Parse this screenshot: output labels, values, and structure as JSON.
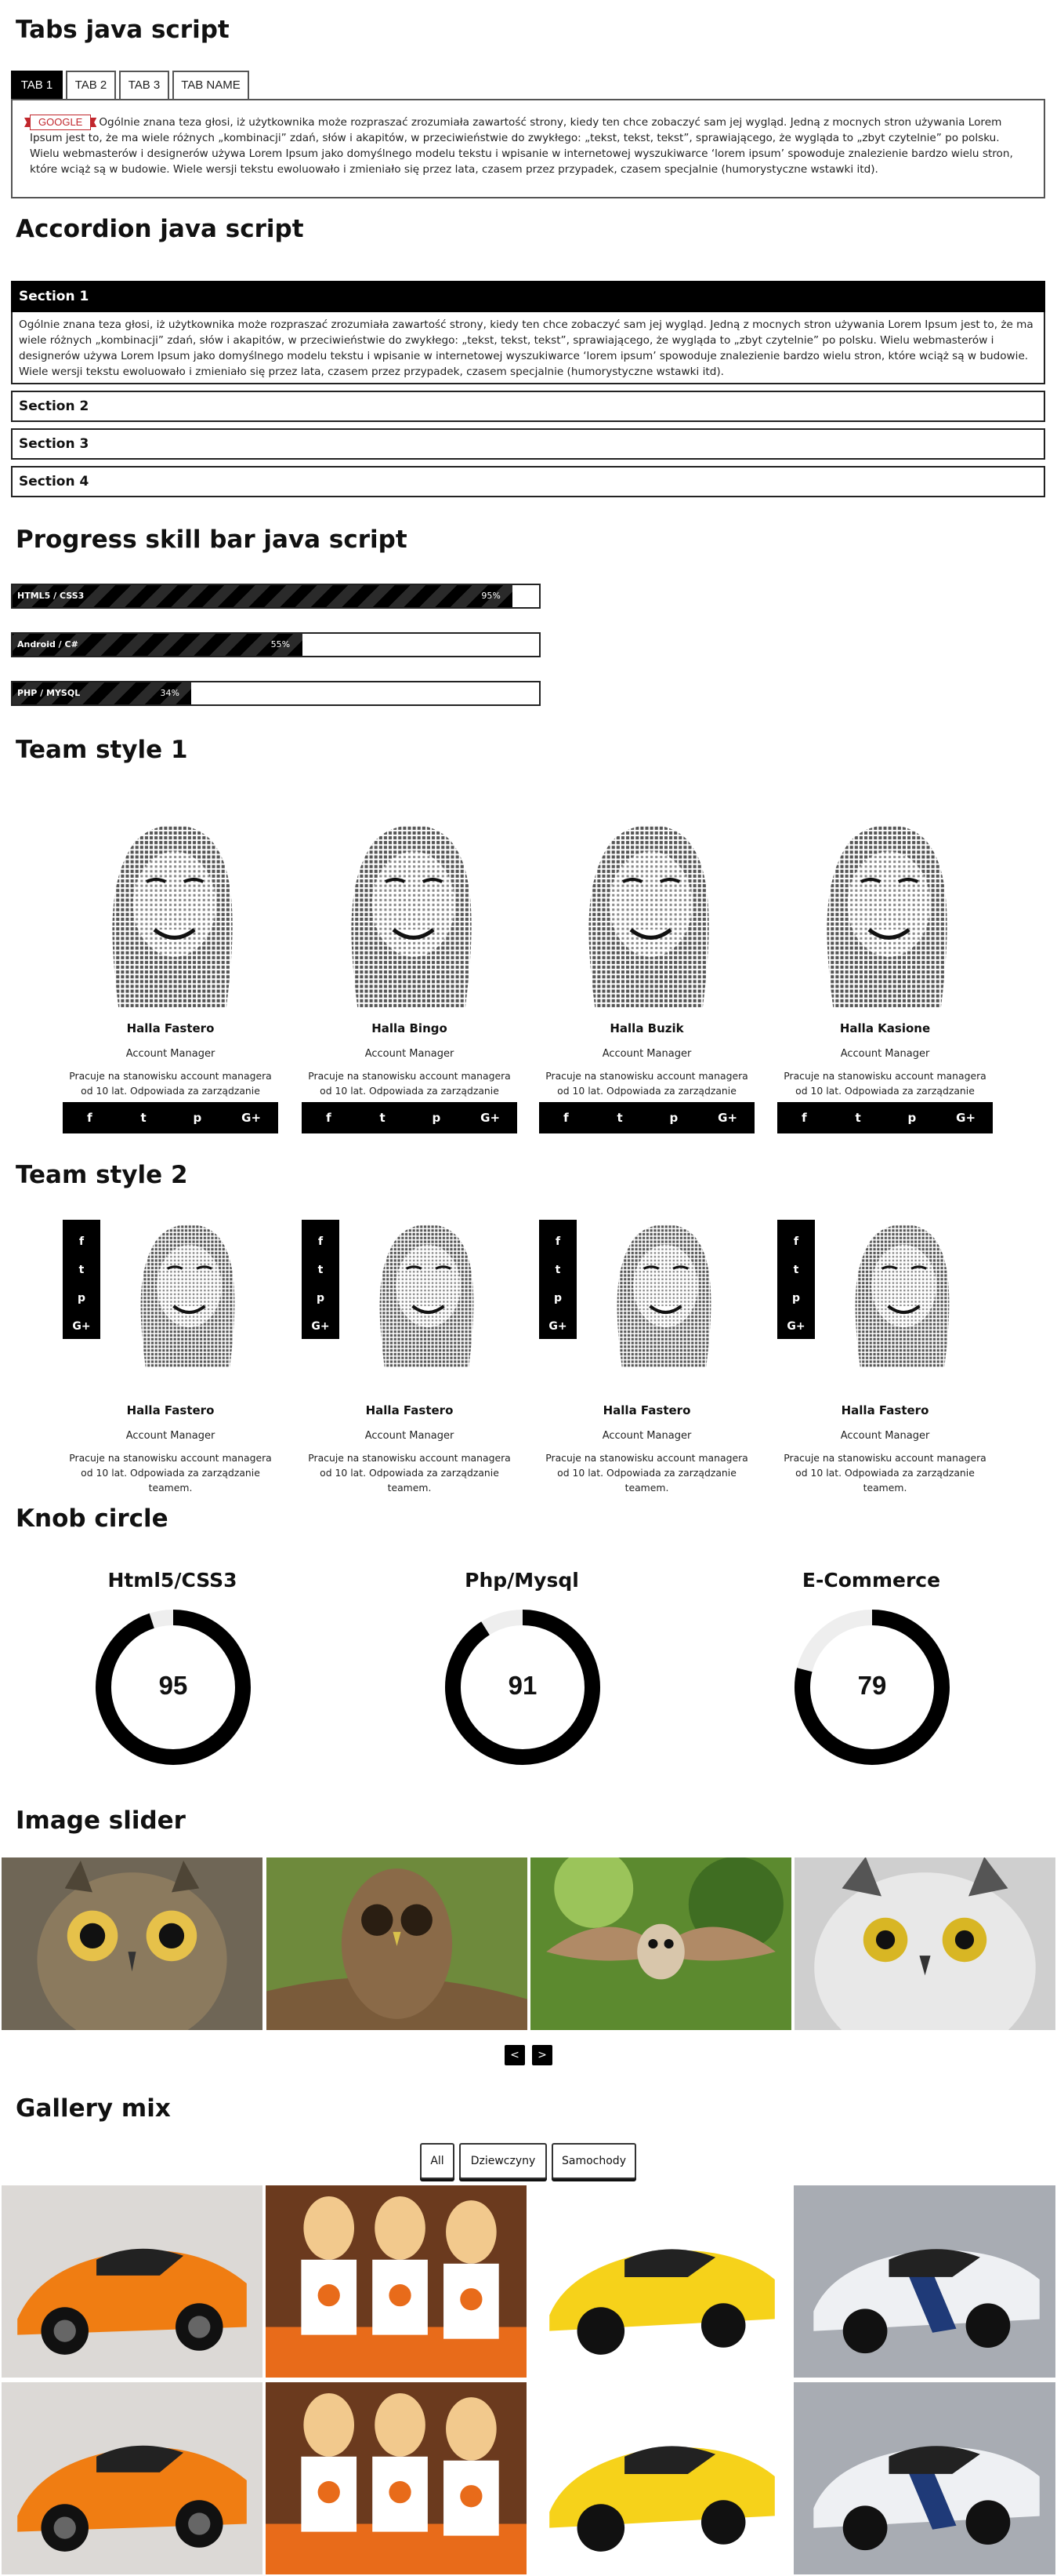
{
  "tabs_section": {
    "title": "Tabs java script",
    "tabs": [
      {
        "label": "TAB 1"
      },
      {
        "label": "TAB 2"
      },
      {
        "label": "TAB 3"
      },
      {
        "label": "TAB NAME"
      }
    ],
    "badge": "GOOGLE",
    "content": "Ogólnie znana teza głosi, iż użytkownika może rozpraszać zrozumiała zawartość strony, kiedy ten chce zobaczyć sam jej wygląd. Jedną z mocnych stron używania Lorem Ipsum jest to, że ma wiele różnych „kombinacji” zdań, słów i akapitów, w przeciwieństwie do zwykłego: „tekst, tekst, tekst”, sprawiającego, że wygląda to „zbyt czytelnie” po polsku. Wielu webmasterów i designerów używa Lorem Ipsum jako domyślnego modelu tekstu i wpisanie w internetowej wyszukiwarce ‘lorem ipsum’ spowoduje znalezienie bardzo wielu stron, które wciąż są w budowie. Wiele wersji tekstu ewoluowało i zmieniało się przez lata, czasem przez przypadek, czasem specjalnie (humorystyczne wstawki itd)."
  },
  "accordion_section": {
    "title": "Accordion java script",
    "sections": [
      {
        "label": "Section 1",
        "content": "Ogólnie znana teza głosi, iż użytkownika może rozpraszać zrozumiała zawartość strony, kiedy ten chce zobaczyć sam jej wygląd. Jedną z mocnych stron używania Lorem Ipsum jest to, że ma wiele różnych „kombinacji” zdań, słów i akapitów, w przeciwieństwie do zwykłego: „tekst, tekst, tekst”, sprawiającego, że wygląda to „zbyt czytelnie” po polsku. Wielu webmasterów i designerów używa Lorem Ipsum jako domyślnego modelu tekstu i wpisanie w internetowej wyszukiwarce ‘lorem ipsum’ spowoduje znalezienie bardzo wielu stron, które wciąż są w budowie. Wiele wersji tekstu ewoluowało i zmieniało się przez lata, czasem przez przypadek, czasem specjalnie (humorystyczne wstawki itd)."
      },
      {
        "label": "Section 2"
      },
      {
        "label": "Section 3"
      },
      {
        "label": "Section 4"
      }
    ]
  },
  "progress_section": {
    "title": "Progress skill bar java script",
    "bars": [
      {
        "label": "HTML5 / CSS3",
        "value": 95,
        "value_label": "95%"
      },
      {
        "label": "Android / C#",
        "value": 55,
        "value_label": "55%"
      },
      {
        "label": "PHP / MYSQL",
        "value": 34,
        "value_label": "34%"
      }
    ]
  },
  "team1": {
    "title": "Team style 1",
    "members": [
      {
        "name": "Halla Fastero",
        "role": "Account Manager",
        "desc": "Pracuje na stanowisku account managera od 10 lat. Odpowiada za zarządzanie teamem."
      },
      {
        "name": "Halla Bingo",
        "role": "Account Manager",
        "desc": "Pracuje na stanowisku account managera od 10 lat. Odpowiada za zarządzanie teamem."
      },
      {
        "name": "Halla Buzik",
        "role": "Account Manager",
        "desc": "Pracuje na stanowisku account managera od 10 lat. Odpowiada za zarządzanie teamem."
      },
      {
        "name": "Halla Kasione",
        "role": "Account Manager",
        "desc": "Pracuje na stanowisku account managera od 10 lat. Odpowiada za zarządzanie teamem."
      }
    ],
    "social": {
      "facebook": "f",
      "twitter": "t",
      "pinterest": "p",
      "gplus": "G+"
    }
  },
  "team2": {
    "title": "Team style 2",
    "members": [
      {
        "name": "Halla Fastero",
        "role": "Account Manager",
        "desc": "Pracuje na stanowisku account managera od 10 lat. Odpowiada za zarządzanie teamem."
      },
      {
        "name": "Halla Fastero",
        "role": "Account Manager",
        "desc": "Pracuje na stanowisku account managera od 10 lat. Odpowiada za zarządzanie teamem."
      },
      {
        "name": "Halla Fastero",
        "role": "Account Manager",
        "desc": "Pracuje na stanowisku account managera od 10 lat. Odpowiada za zarządzanie teamem."
      },
      {
        "name": "Halla Fastero",
        "role": "Account Manager",
        "desc": "Pracuje na stanowisku account managera od 10 lat. Odpowiada za zarządzanie teamem."
      }
    ],
    "social": {
      "facebook": "f",
      "twitter": "t",
      "pinterest": "p",
      "gplus": "G+"
    }
  },
  "knob_section": {
    "title": "Knob circle",
    "knobs": [
      {
        "title": "Html5/CSS3",
        "value": 95
      },
      {
        "title": "Php/Mysql",
        "value": 91
      },
      {
        "title": "E-Commerce",
        "value": 79
      }
    ],
    "colors": {
      "fill": "#000000",
      "track": "#eeeeee"
    }
  },
  "slider_section": {
    "title": "Image slider",
    "prev": "<",
    "next": ">"
  },
  "gallery_section": {
    "title": "Gallery mix",
    "filters": [
      {
        "label": "All"
      },
      {
        "label": "Dziewczyny"
      },
      {
        "label": "Samochody"
      }
    ]
  }
}
